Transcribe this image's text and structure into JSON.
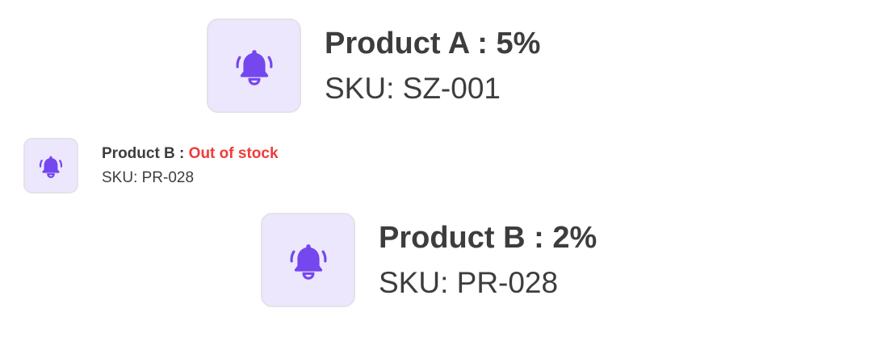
{
  "colors": {
    "icon_bg": "#ede7fd",
    "icon_border": "#e4e1ea",
    "bell": "#7447ef",
    "text": "#3d3d3d",
    "out_of_stock": "#ef3b3b"
  },
  "notifications": [
    {
      "icon": "bell-ringing-icon",
      "product": "Product A",
      "separator": " : ",
      "status": "5%",
      "sku": "SKU: SZ-001"
    },
    {
      "icon": "bell-ringing-icon",
      "product": "Product B",
      "separator": " : ",
      "status": "Out of stock",
      "sku": "SKU: PR-028"
    },
    {
      "icon": "bell-ringing-icon",
      "product": "Product B",
      "separator": " : ",
      "status": "2%",
      "sku": "SKU: PR-028"
    }
  ]
}
